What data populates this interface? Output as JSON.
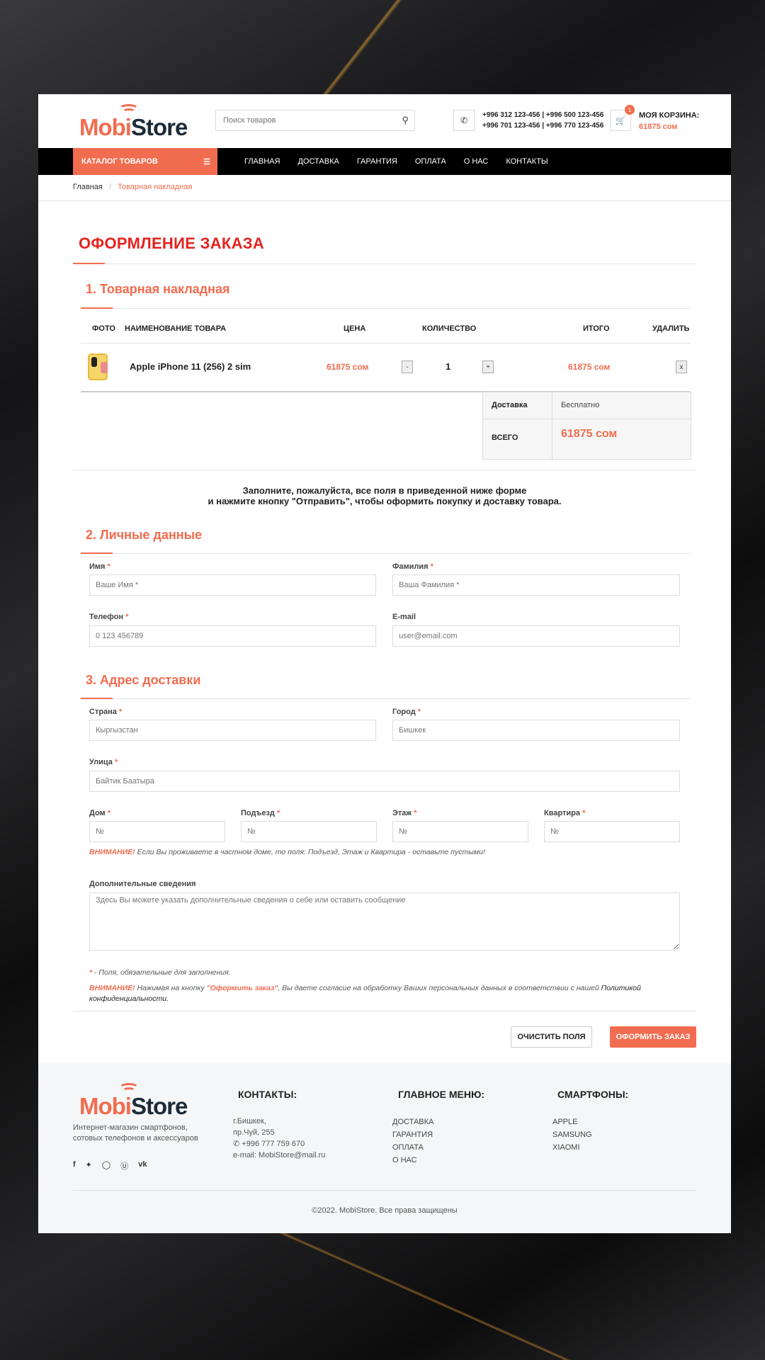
{
  "header": {
    "logo_mobi": "Mobi",
    "logo_store": "Store",
    "search_placeholder": "Поиск товаров",
    "phones_line1": "+996 312 123-456 | +996 500 123-456",
    "phones_line2": "+996 701 123-456 | +996 770 123-456",
    "cart_badge": "1",
    "cart_label": "МОЯ КОРЗИНА:",
    "cart_total": "61875 сом"
  },
  "nav": {
    "catalog": "КАТАЛОГ ТОВАРОВ",
    "links": [
      "ГЛАВНАЯ",
      "ДОСТАВКА",
      "ГАРАНТИЯ",
      "ОПЛАТА",
      "О НАС",
      "КОНТАКТЫ"
    ]
  },
  "breadcrumb": {
    "home": "Главная",
    "sep": "/",
    "current": "Товарная накладная"
  },
  "page_title": "ОФОРМЛЕНИЕ ЗАКАЗА",
  "section1": {
    "title": "1. Товарная накладная",
    "headers": {
      "photo": "ФОТО",
      "name": "НАИМЕНОВАНИЕ ТОВАРА",
      "price": "ЦЕНА",
      "qty": "КОЛИЧЕСТВО",
      "total": "ИТОГО",
      "delete": "УДАЛИТЬ"
    },
    "item": {
      "name": "Apple iPhone 11 (256) 2 sim",
      "price": "61875 сом",
      "minus": "-",
      "qty": "1",
      "plus": "+",
      "total": "61875 сом",
      "remove": "x"
    },
    "delivery_label": "Доставка",
    "delivery_value": "Бесплатно",
    "grand_label": "ВСЕГО",
    "grand_value": "61875 сом"
  },
  "notice": {
    "line1": "Заполните, пожалуйста, все поля в приведенной ниже форме",
    "line2": "и нажмите кнопку \"Отправить\", чтобы оформить покупку и доставку товара."
  },
  "section2": {
    "title": "2. Личные данные",
    "name_label": "Имя",
    "name_ph": "Ваше Имя *",
    "surname_label": "Фамилия",
    "surname_ph": "Ваша Фамилия *",
    "phone_label": "Телефон",
    "phone_ph": "0 123 456789",
    "email_label": "E-mail",
    "email_ph": "user@email.com"
  },
  "section3": {
    "title": "3. Адрес доставки",
    "country_label": "Страна",
    "country_ph": "Кыргызстан",
    "city_label": "Город",
    "city_ph": "Бишкек",
    "street_label": "Улица",
    "street_ph": "Байтик Баатыра",
    "house_label": "Дом",
    "entrance_label": "Подъезд",
    "floor_label": "Этаж",
    "flat_label": "Квартира",
    "num_ph": "№",
    "warn_prefix": "ВНИМАНИЕ!",
    "warn_text": " Если Вы проживаете в частном доме, то поля: Подъезд, Этаж и Квартира - оставьте пустыми!",
    "extra_label": "Дополнительные сведения",
    "extra_ph": "Здесь Вы можете указать дополнительные сведения о себе или оставить сообщение"
  },
  "required_star": "*",
  "required_note": " - Поля, обязательные для заполнения.",
  "consent": {
    "prefix": "ВНИМАНИЕ!",
    "part1": " Нажимая на кнопку ",
    "btn": "\"Оформить заказ\"",
    "part2": ", Вы даете согласие на обработку Ваших персональных данных в соответствии с нашей ",
    "link": "Политикой",
    "part3": "конфиденциальности."
  },
  "buttons": {
    "clear": "ОЧИСТИТЬ ПОЛЯ",
    "submit": "ОФОРМИТЬ ЗАКАЗ"
  },
  "footer": {
    "desc1": "Интернет-магазин смартфонов,",
    "desc2": "сотовых телефонов и аксессуаров",
    "contacts_title": "КОНТАКТЫ:",
    "addr1": "г.Бишкек,",
    "addr2": "пр.Чуй, 255",
    "phone": "+996 777 759 670",
    "email": "e-mail: MobiStore@mail.ru",
    "menu_title": "ГЛАВНОЕ МЕНЮ:",
    "menu": [
      "ДОСТАВКА",
      "ГАРАНТИЯ",
      "ОПЛАТА",
      "О НАС"
    ],
    "phones_title": "СМАРТФОНЫ:",
    "brands": [
      "APPLE",
      "SAMSUNG",
      "XIAOMI"
    ],
    "copyright": "©2022. MobiStore. Все права защищены"
  },
  "colors": {
    "accent": "#f26c4f",
    "title_red": "#e4231f",
    "nav_bg": "#000000"
  }
}
